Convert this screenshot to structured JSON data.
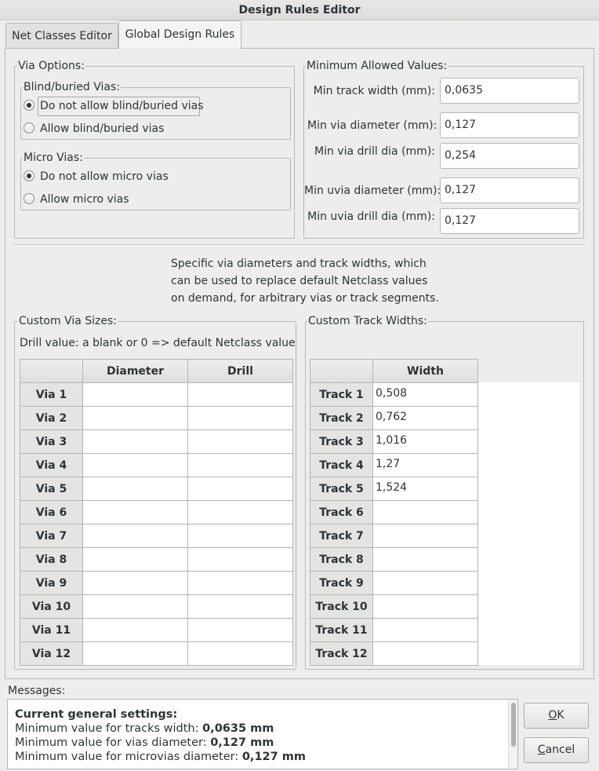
{
  "window": {
    "title": "Design Rules Editor"
  },
  "tabs": [
    {
      "label": "Net Classes Editor"
    },
    {
      "label": "Global Design Rules"
    }
  ],
  "via_options": {
    "title": "Via Options:",
    "blind": {
      "title": "Blind/buried Vias:",
      "options": [
        "Do not allow blind/buried vias",
        "Allow blind/buried vias"
      ],
      "selected": "Do not allow blind/buried vias"
    },
    "micro": {
      "title": "Micro Vias:",
      "options": [
        "Do not allow micro vias",
        "Allow micro vias"
      ],
      "selected": "Do not allow micro vias"
    }
  },
  "min_values": {
    "title": "Minimum Allowed Values:",
    "fields": [
      {
        "label": "Min track width (mm):",
        "value": "0,0635"
      },
      {
        "label": "Min via diameter (mm):",
        "value": "0,127"
      },
      {
        "label": "Min via drill dia (mm):",
        "value": "0,254"
      },
      {
        "label": "Min uvia diameter (mm):",
        "value": "0,127"
      },
      {
        "label": "Min uvia drill dia (mm):",
        "value": "0,127"
      }
    ]
  },
  "info_lines": [
    "Specific via diameters and track widths, which",
    "can be used to replace default Netclass values",
    "on demand, for arbitrary vias or track segments."
  ],
  "custom_via": {
    "title": "Custom Via Sizes:",
    "note": "Drill value: a blank or 0 => default Netclass value",
    "columns": [
      "Diameter",
      "Drill"
    ],
    "rows": [
      "Via 1",
      "Via 2",
      "Via 3",
      "Via 4",
      "Via 5",
      "Via 6",
      "Via 7",
      "Via 8",
      "Via 9",
      "Via 10",
      "Via 11",
      "Via 12"
    ]
  },
  "custom_track": {
    "title": "Custom Track Widths:",
    "columns": [
      "Width"
    ],
    "rows": [
      {
        "label": "Track 1",
        "width": "0,508"
      },
      {
        "label": "Track 2",
        "width": "0,762"
      },
      {
        "label": "Track 3",
        "width": "1,016"
      },
      {
        "label": "Track 4",
        "width": "1,27"
      },
      {
        "label": "Track 5",
        "width": "1,524"
      },
      {
        "label": "Track 6",
        "width": ""
      },
      {
        "label": "Track 7",
        "width": ""
      },
      {
        "label": "Track 8",
        "width": ""
      },
      {
        "label": "Track 9",
        "width": ""
      },
      {
        "label": "Track 10",
        "width": ""
      },
      {
        "label": "Track 11",
        "width": ""
      },
      {
        "label": "Track 12",
        "width": ""
      }
    ]
  },
  "messages": {
    "title": "Messages:",
    "heading": "Current general settings:",
    "lines": [
      {
        "text": "Minimum value for tracks width: ",
        "value": "0,0635 mm"
      },
      {
        "text": "Minimum value for vias diameter: ",
        "value": "0,127 mm"
      },
      {
        "text": "Minimum value for microvias diameter: ",
        "value": "0,127 mm"
      }
    ]
  },
  "buttons": {
    "ok": {
      "mnemonic": "O",
      "rest": "K"
    },
    "cancel": {
      "mnemonic": "C",
      "rest": "ancel"
    }
  }
}
